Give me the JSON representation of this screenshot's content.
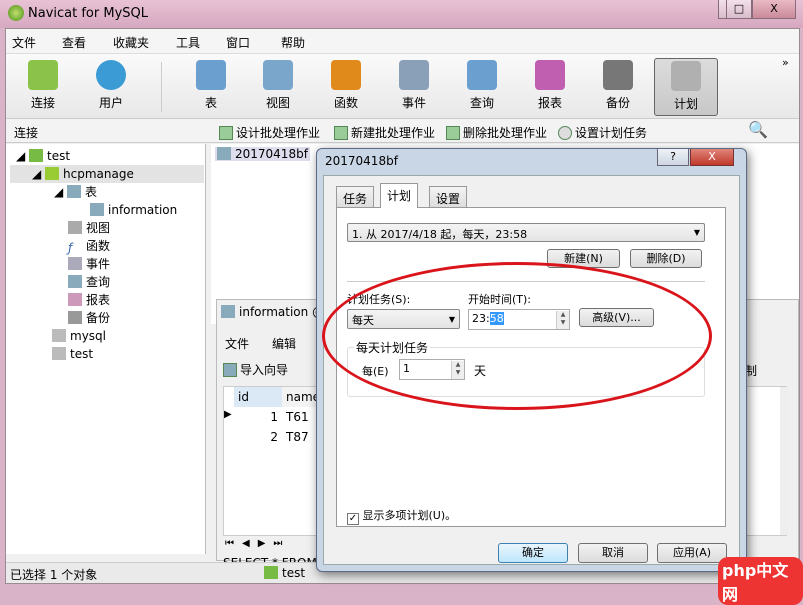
{
  "window": {
    "title": "Navicat for MySQL",
    "min": "▭",
    "max": "□",
    "close": "X"
  },
  "menu": [
    "文件",
    "查看",
    "收藏夹",
    "工具",
    "窗口",
    "帮助"
  ],
  "toolbar": [
    {
      "label": "连接",
      "color": "#8bc34a"
    },
    {
      "label": "用户",
      "color": "#3a9bd5"
    },
    {
      "label": "表",
      "color": "#6a9fd0"
    },
    {
      "label": "视图",
      "color": "#7aa6cc"
    },
    {
      "label": "函数",
      "color": "#e08a1c"
    },
    {
      "label": "事件",
      "color": "#8aa0b8"
    },
    {
      "label": "查询",
      "color": "#6a9fd0"
    },
    {
      "label": "报表",
      "color": "#c05fb0"
    },
    {
      "label": "备份",
      "color": "#777777"
    },
    {
      "label": "计划",
      "color": "#b0b0b0"
    }
  ],
  "toolbar_more": "»",
  "subbar": {
    "section": "连接",
    "actions": [
      "设计批处理作业",
      "新建批处理作业",
      "删除批处理作业",
      "设置计划任务"
    ]
  },
  "tree": [
    {
      "label": "test",
      "level": 0
    },
    {
      "label": "hcpmanage",
      "level": 1
    },
    {
      "label": "表",
      "level": 2
    },
    {
      "label": "information",
      "level": 3
    },
    {
      "label": "视图",
      "level": 2
    },
    {
      "label": "函数",
      "level": 2
    },
    {
      "label": "事件",
      "level": 2
    },
    {
      "label": "查询",
      "level": 2
    },
    {
      "label": "报表",
      "level": 2
    },
    {
      "label": "备份",
      "level": 2
    },
    {
      "label": "mysql",
      "level": 1
    },
    {
      "label": "test",
      "level": 1
    }
  ],
  "objects": [
    "20170418bf"
  ],
  "subwin": {
    "title": "information @",
    "menu": [
      "文件",
      "编辑"
    ],
    "import": "导入向导",
    "right_text": "制",
    "columns": [
      "id",
      "name"
    ],
    "rows": [
      [
        "1",
        "T61"
      ],
      [
        "2",
        "T87"
      ]
    ],
    "sql": "SELECT * FROM `"
  },
  "status": {
    "left": "已选择 1 个对象",
    "conn": "test"
  },
  "dialog": {
    "title": "20170418bf",
    "help": "?",
    "close": "X",
    "tabs": [
      "任务",
      "计划",
      "设置"
    ],
    "active_tab": "计划",
    "schedule": "1. 从 2017/4/18 起，每天，23:58",
    "new_btn": "新建(N)",
    "delete_btn": "删除(D)",
    "task_label": "计划任务(S):",
    "task_value": "每天",
    "time_label": "开始时间(T):",
    "time_hour": "23:",
    "time_min": "58",
    "advanced": "高级(V)...",
    "group_title": "每天计划任务",
    "every_label": "每(E)",
    "every_value": "1",
    "day_unit": "天",
    "show_multi": "显示多项计划(U)。",
    "show_multi_checked": true,
    "ok": "确定",
    "cancel": "取消",
    "apply": "应用(A)"
  },
  "watermark": "php中文网"
}
